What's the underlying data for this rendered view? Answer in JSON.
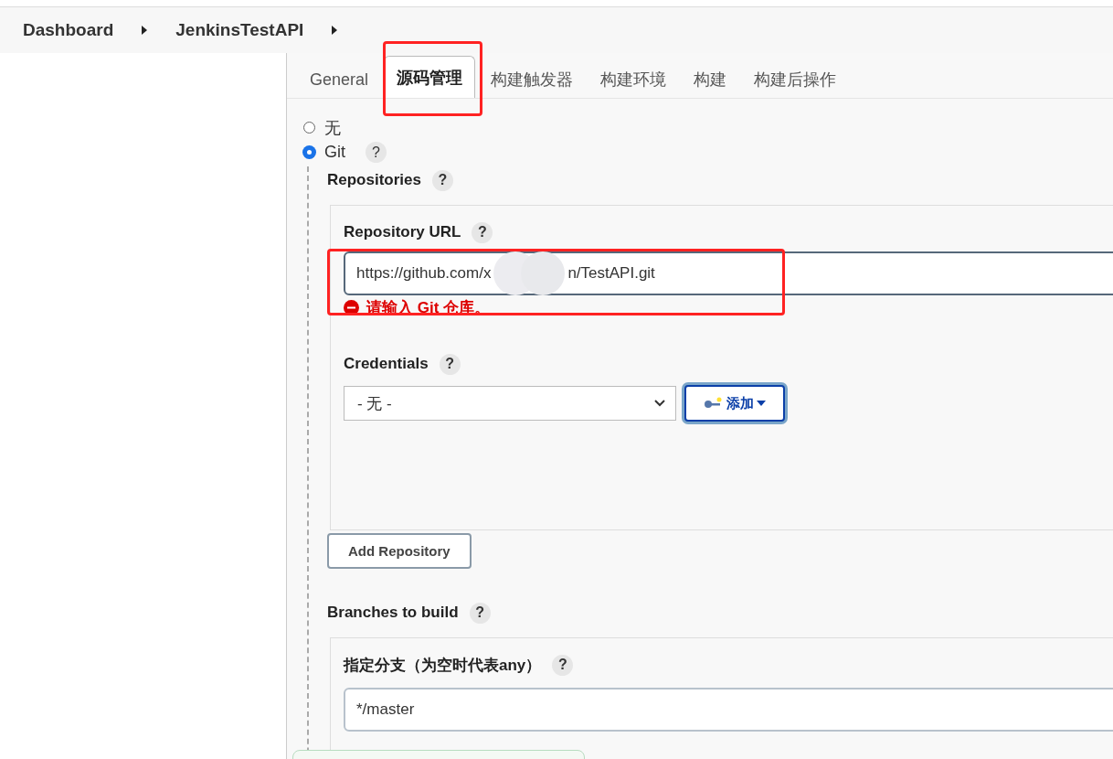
{
  "breadcrumbs": [
    "Dashboard",
    "JenkinsTestAPI"
  ],
  "tabs": [
    {
      "label": "General",
      "selected": false
    },
    {
      "label": "源码管理",
      "selected": true
    },
    {
      "label": "构建触发器",
      "selected": false
    },
    {
      "label": "构建环境",
      "selected": false
    },
    {
      "label": "构建",
      "selected": false
    },
    {
      "label": "构建后操作",
      "selected": false
    }
  ],
  "scm_options": [
    {
      "label": "无",
      "selected": false
    },
    {
      "label": "Git",
      "selected": true,
      "help": "?"
    }
  ],
  "repositories": {
    "title": "Repositories",
    "help": "?",
    "url": {
      "label": "Repository URL",
      "help": "?",
      "value_parts": [
        "https://github.com/x",
        "n/TestAPI.git"
      ],
      "error": "请输入 Git 仓库。"
    },
    "credentials": {
      "label": "Credentials",
      "help": "?",
      "value": "- 无 -",
      "add_button": "添加"
    },
    "add_button": "Add Repository"
  },
  "branches": {
    "title": "Branches to build",
    "help": "?",
    "specifier": {
      "label": "指定分支（为空时代表any）",
      "help": "?",
      "value": "*/master"
    }
  }
}
